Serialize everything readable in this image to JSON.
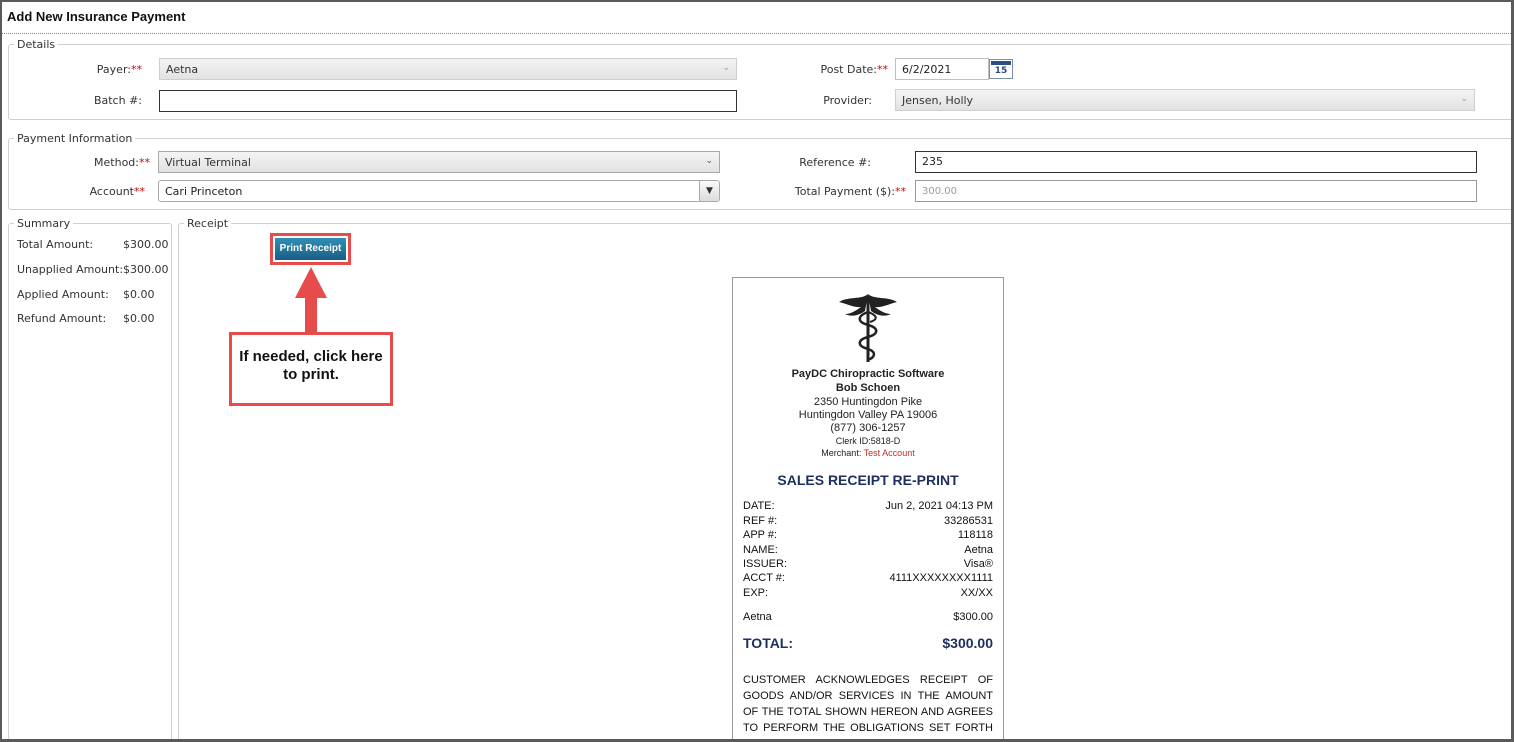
{
  "window": {
    "title": "Add New Insurance Payment"
  },
  "details": {
    "legend": "Details",
    "payer_label": "Payer:",
    "payer_value": "Aetna",
    "batch_label": "Batch #:",
    "batch_value": "",
    "post_date_label": "Post Date:",
    "post_date_value": "6/2/2021",
    "calendar_day": "15",
    "provider_label": "Provider:",
    "provider_value": "Jensen, Holly",
    "required_mark": "**"
  },
  "payment_info": {
    "legend": "Payment Information",
    "method_label": "Method:",
    "method_value": "Virtual Terminal",
    "account_label": "Account",
    "account_value": "Cari Princeton",
    "reference_label": "Reference #:",
    "reference_value": "235",
    "total_payment_label": "Total Payment ($):",
    "total_payment_placeholder": "300.00"
  },
  "summary": {
    "legend": "Summary",
    "rows": [
      {
        "label": "Total Amount:",
        "value": "$300.00"
      },
      {
        "label": "Unapplied Amount:",
        "value": "$300.00"
      },
      {
        "label": "Applied Amount:",
        "value": "$0.00"
      },
      {
        "label": "Refund Amount:",
        "value": "$0.00"
      }
    ]
  },
  "receipt_section": {
    "legend": "Receipt",
    "print_button": "Print Receipt",
    "callout_text": "If needed, click here to print.",
    "colors": {
      "accent": "#e74c4c",
      "button": "#1f6e98",
      "navy": "#1e2f5e"
    }
  },
  "receipt": {
    "company": "PayDC Chiropractic Software",
    "name": "Bob Schoen",
    "address1": "2350 Huntingdon Pike",
    "address2": "Huntingdon Valley PA 19006",
    "phone": "(877) 306-1257",
    "clerk": "Clerk ID:5818-D",
    "merchant_label": "Merchant:",
    "merchant_value": "Test Account",
    "heading": "SALES RECEIPT RE-PRINT",
    "rows": [
      {
        "label": "DATE:",
        "value": "Jun 2, 2021 04:13 PM"
      },
      {
        "label": "REF #:",
        "value": "33286531"
      },
      {
        "label": "APP #:",
        "value": "118118"
      },
      {
        "label": "NAME:",
        "value": "Aetna"
      },
      {
        "label": "ISSUER:",
        "value": "Visa®"
      },
      {
        "label": "ACCT #:",
        "value": "4111XXXXXXXX1111"
      },
      {
        "label": "EXP:",
        "value": "XX/XX"
      }
    ],
    "item_label": "Aetna",
    "item_value": "$300.00",
    "total_label": "TOTAL:",
    "total_value": "$300.00",
    "acknowledgement": "CUSTOMER ACKNOWLEDGES RECEIPT OF GOODS AND/OR SERVICES IN THE AMOUNT OF THE TOTAL SHOWN HEREON AND AGREES TO PERFORM THE OBLIGATIONS SET FORTH BY THE CUSTOMER'S AGREEMENT WITH THE"
  }
}
